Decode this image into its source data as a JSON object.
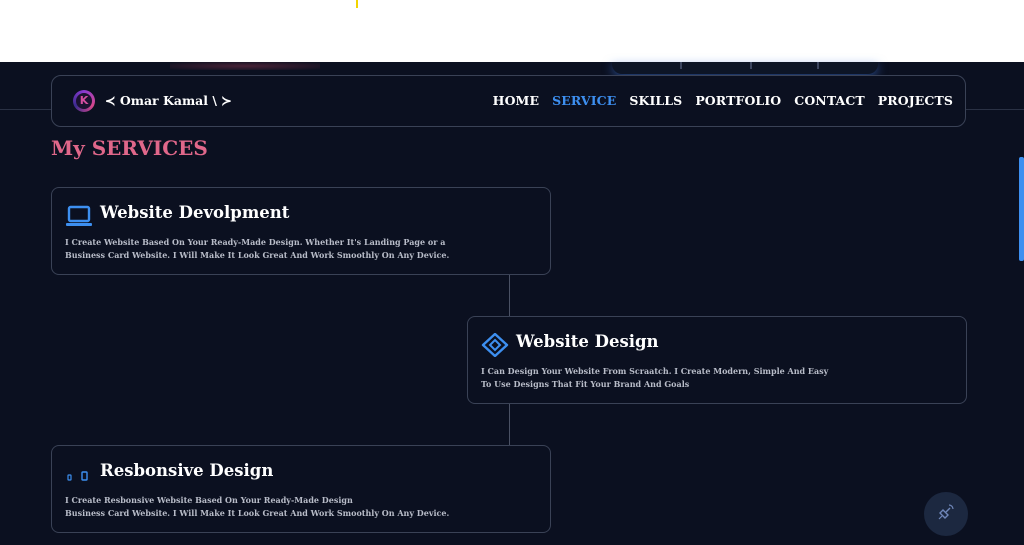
{
  "navbar": {
    "brand": "≺ Omar Kamal \\ ≻",
    "logo_letter": "K",
    "links": [
      {
        "label": "HOME",
        "active": false
      },
      {
        "label": "SERVICE",
        "active": true
      },
      {
        "label": "SKILLS",
        "active": false
      },
      {
        "label": "PORTFOLIO",
        "active": false
      },
      {
        "label": "CONTACT",
        "active": false
      },
      {
        "label": "PROJECTS",
        "active": false
      }
    ]
  },
  "section": {
    "title": "My SERVICES"
  },
  "services": [
    {
      "icon": "laptop-icon",
      "title": "Website Devolpment",
      "line1": "I Create Website Based On Your Ready-Made Design. Whether It's Landing Page or a",
      "line2": "Business Card Website. I Will Make It Look Great And Work Smoothly On Any Device."
    },
    {
      "icon": "design-diamond-icon",
      "title": "Website Design",
      "line1": "I Can Design Your Website From Scraatch. I Create Modern, Simple And Easy",
      "line2": "To Use Designs That Fit Your Brand And Goals"
    },
    {
      "icon": "devices-icon",
      "title": "Resbonsive Design",
      "line1": "I Create Resbonsive Website Based On Your Ready-Made Design",
      "line2": "Business Card Website. I Will Make It Look Great And Work Smoothly On Any Device."
    }
  ],
  "colors": {
    "background": "#0b1020",
    "accent": "#3d8ff0",
    "section_title": "#e0678a"
  },
  "floating_button": {
    "icon": "satellite-icon"
  }
}
